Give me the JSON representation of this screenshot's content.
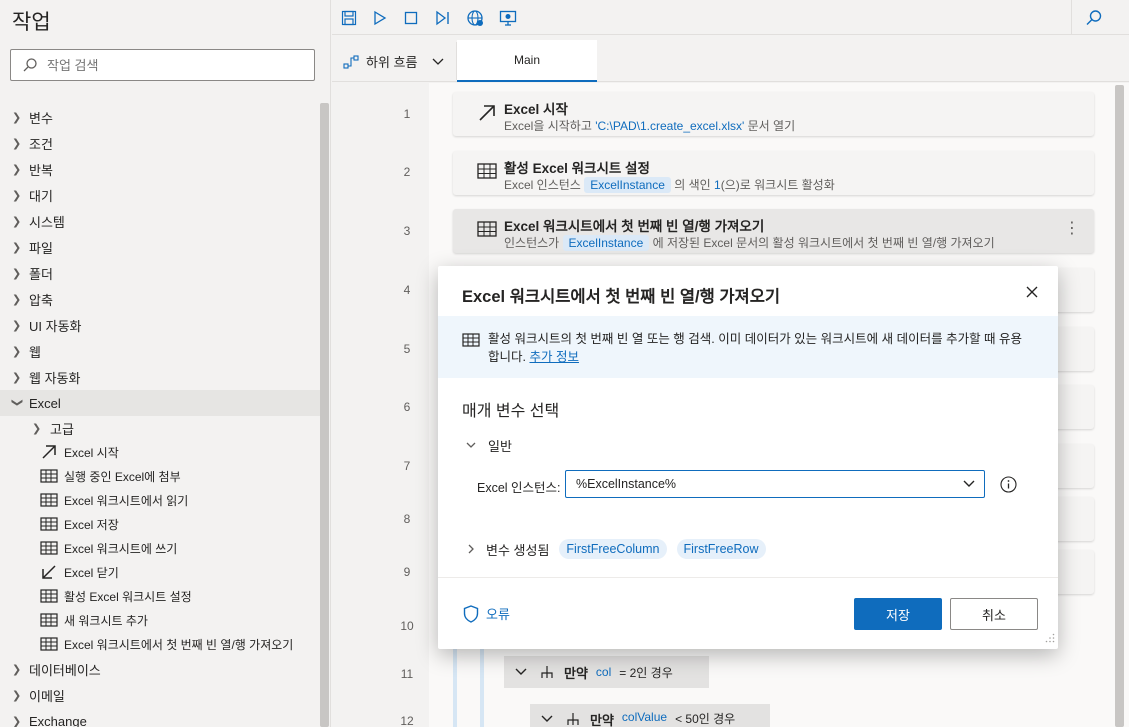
{
  "sidebar": {
    "title": "작업",
    "search_placeholder": "작업 검색",
    "categories": [
      {
        "label": "변수"
      },
      {
        "label": "조건"
      },
      {
        "label": "반복"
      },
      {
        "label": "대기"
      },
      {
        "label": "시스템"
      },
      {
        "label": "파일"
      },
      {
        "label": "폴더"
      },
      {
        "label": "압축"
      },
      {
        "label": "UI 자동화"
      },
      {
        "label": "웹"
      },
      {
        "label": "웹 자동화"
      }
    ],
    "excel": {
      "label": "Excel",
      "advanced": "고급",
      "actions": [
        {
          "label": "Excel 시작",
          "icon": "arrow-up-right-icon"
        },
        {
          "label": "실행 중인 Excel에 첨부",
          "icon": "excel-grid-icon"
        },
        {
          "label": "Excel 워크시트에서 읽기",
          "icon": "excel-grid-icon"
        },
        {
          "label": "Excel 저장",
          "icon": "excel-grid-icon"
        },
        {
          "label": "Excel 워크시트에 쓰기",
          "icon": "excel-grid-icon"
        },
        {
          "label": "Excel 닫기",
          "icon": "arrow-down-left-icon"
        },
        {
          "label": "활성 Excel 워크시트 설정",
          "icon": "excel-grid-icon"
        },
        {
          "label": "새 워크시트 추가",
          "icon": "excel-grid-icon"
        },
        {
          "label": "Excel 워크시트에서 첫 번째 빈 열/행 가져오기",
          "icon": "excel-grid-icon"
        }
      ]
    },
    "after": [
      {
        "label": "데이터베이스"
      },
      {
        "label": "이메일"
      },
      {
        "label": "Exchange"
      }
    ]
  },
  "toolbar": {
    "icons": [
      "save-icon",
      "run-icon",
      "stop-icon",
      "step-icon",
      "web-recorder-icon",
      "desktop-recorder-icon",
      "search-icon"
    ]
  },
  "tabs": {
    "subflow_label": "하위 흐름",
    "main_label": "Main"
  },
  "canvas": {
    "line_numbers": [
      "1",
      "2",
      "3",
      "4",
      "5",
      "6",
      "7",
      "8",
      "9",
      "10",
      "11",
      "12"
    ],
    "steps": [
      {
        "title": "Excel 시작",
        "desc_pre": "Excel을 시작하고 ",
        "desc_hl": "'C:\\PAD\\1.create_excel.xlsx'",
        "desc_post": " 문서 열기"
      },
      {
        "title": "활성 Excel 워크시트 설정",
        "desc_pre": "Excel 인스턴스 ",
        "chip": "ExcelInstance",
        "desc_post": " 의 색인 ",
        "desc_hl2": "1",
        "desc_post2": "(으)로 워크시트 활성화"
      },
      {
        "title": "Excel 워크시트에서 첫 번째 빈 열/행 가져오기",
        "desc_pre": "인스턴스가 ",
        "chip": "ExcelInstance",
        "desc_post": " 에 저장된 Excel 문서의 활성 워크시트에서 첫 번째 빈 열/행 가져오기"
      }
    ],
    "nested": [
      {
        "keyword": "만약",
        "var": "col",
        "op": "= 2인 경우"
      },
      {
        "keyword": "만약",
        "var": "colValue",
        "op": "< 50인 경우"
      }
    ]
  },
  "dialog": {
    "title": "Excel 워크시트에서 첫 번째 빈 열/행 가져오기",
    "info_text": "활성 워크시트의 첫 번째 빈 열 또는 행 검색. 이미 데이터가 있는 워크시트에 새 데이터를 추가할 때 유용합니다.",
    "info_link": "추가 정보",
    "section_title": "매개 변수 선택",
    "group_label": "일반",
    "instance_label": "Excel 인스턴스:",
    "instance_value": "%ExcelInstance%",
    "vars_label": "변수 생성됨",
    "vars": [
      "FirstFreeColumn",
      "FirstFreeRow"
    ],
    "error_label": "오류",
    "save_label": "저장",
    "cancel_label": "취소"
  },
  "colors": {
    "accent": "#0f6cbd",
    "chip_bg": "#dbe9f7"
  }
}
